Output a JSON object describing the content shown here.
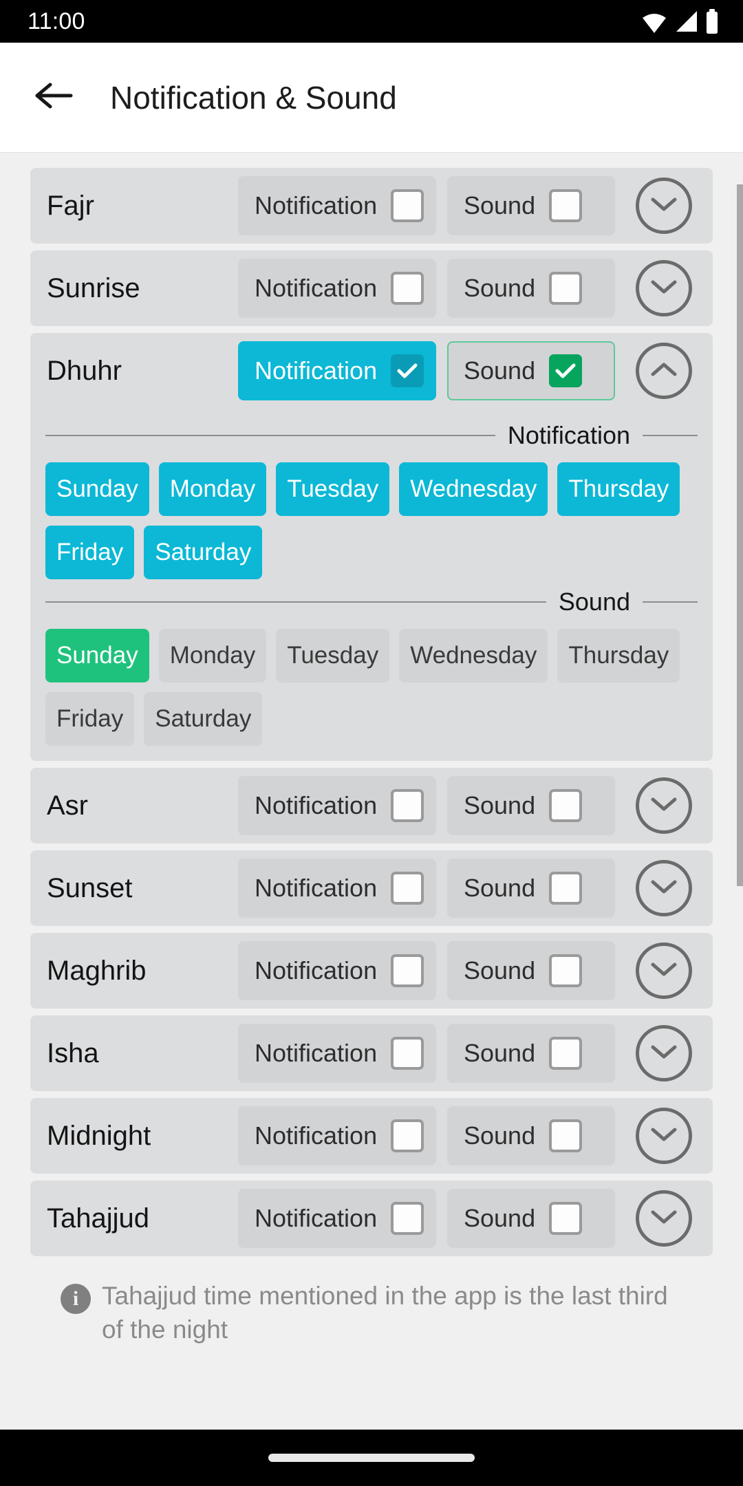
{
  "status_bar": {
    "time": "11:00",
    "icons": [
      "wifi-icon",
      "cellular-signal-icon",
      "battery-icon"
    ]
  },
  "app_bar": {
    "back_icon": "back-arrow-icon",
    "title": "Notification & Sound"
  },
  "labels": {
    "notification": "Notification",
    "sound": "Sound",
    "expand_icon": "chevron-down-icon",
    "collapse_icon": "chevron-up-icon"
  },
  "colors": {
    "notification_active": "#0cb8d6",
    "notification_check": "#0a9cb6",
    "sound_active": "#1fc27d",
    "sound_check": "#07a45e",
    "sound_border": "#5cc99a",
    "chip_inactive": "#d2d3d5",
    "card_bg": "#dcdddf",
    "page_bg": "#f0f0f0"
  },
  "prayers": [
    {
      "name": "Fajr",
      "notification_on": false,
      "sound_on": false,
      "expanded": false
    },
    {
      "name": "Sunrise",
      "notification_on": false,
      "sound_on": false,
      "expanded": false
    },
    {
      "name": "Dhuhr",
      "notification_on": true,
      "sound_on": true,
      "expanded": true
    },
    {
      "name": "Asr",
      "notification_on": false,
      "sound_on": false,
      "expanded": false
    },
    {
      "name": "Sunset",
      "notification_on": false,
      "sound_on": false,
      "expanded": false
    },
    {
      "name": "Maghrib",
      "notification_on": false,
      "sound_on": false,
      "expanded": false
    },
    {
      "name": "Isha",
      "notification_on": false,
      "sound_on": false,
      "expanded": false
    },
    {
      "name": "Midnight",
      "notification_on": false,
      "sound_on": false,
      "expanded": false
    },
    {
      "name": "Tahajjud",
      "notification_on": false,
      "sound_on": false,
      "expanded": false
    }
  ],
  "expanded_panel": {
    "prayer": "Dhuhr",
    "notification_section": {
      "title": "Notification",
      "days": [
        {
          "label": "Sunday",
          "selected": true
        },
        {
          "label": "Monday",
          "selected": true
        },
        {
          "label": "Tuesday",
          "selected": true
        },
        {
          "label": "Wednesday",
          "selected": true
        },
        {
          "label": "Thursday",
          "selected": true
        },
        {
          "label": "Friday",
          "selected": true
        },
        {
          "label": "Saturday",
          "selected": true
        }
      ]
    },
    "sound_section": {
      "title": "Sound",
      "days": [
        {
          "label": "Sunday",
          "selected": true
        },
        {
          "label": "Monday",
          "selected": false
        },
        {
          "label": "Tuesday",
          "selected": false
        },
        {
          "label": "Wednesday",
          "selected": false
        },
        {
          "label": "Thursday",
          "selected": false
        },
        {
          "label": "Friday",
          "selected": false
        },
        {
          "label": "Saturday",
          "selected": false
        }
      ]
    }
  },
  "footer": {
    "info_icon": "info-icon",
    "info_glyph": "i",
    "text": "Tahajjud time mentioned in the app is the last third of the night"
  },
  "nav_bar": {
    "home_indicator": "home-indicator-pill"
  }
}
